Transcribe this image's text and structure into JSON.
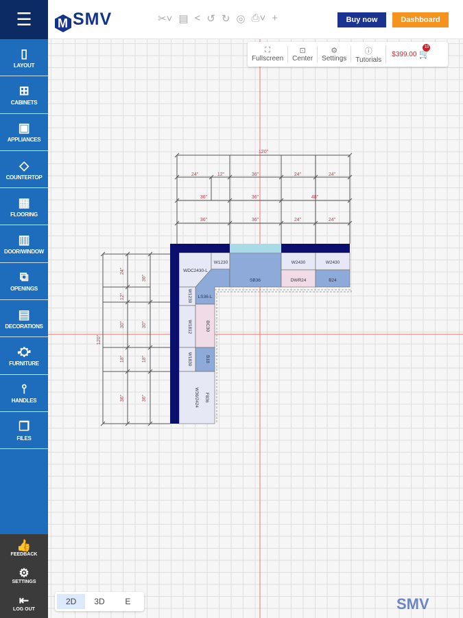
{
  "header": {
    "logo": "SMV",
    "buy_now": "Buy now",
    "dashboard": "Dashboard",
    "tools": [
      "scissors-icon",
      "save-icon",
      "share-icon",
      "undo-icon",
      "redo-icon",
      "camera-icon",
      "print-icon",
      "plus-icon"
    ]
  },
  "sidebar": {
    "items": [
      {
        "label": "LAYOUT",
        "icon": "▯"
      },
      {
        "label": "CABINETS",
        "icon": "⊞"
      },
      {
        "label": "APPLIANCES",
        "icon": "▣"
      },
      {
        "label": "COUNTERTOP",
        "icon": "◇"
      },
      {
        "label": "FLOORING",
        "icon": "▦"
      },
      {
        "label": "DOOR/WINDOW",
        "icon": "▥"
      },
      {
        "label": "OPENINGS",
        "icon": "⧉"
      },
      {
        "label": "DECORATIONS",
        "icon": "▤"
      },
      {
        "label": "FURNITURE",
        "icon": "⛮"
      },
      {
        "label": "HANDLES",
        "icon": "⫯"
      },
      {
        "label": "FILES",
        "icon": "❐"
      }
    ],
    "bottom": [
      {
        "label": "FEEDBACK",
        "icon": "👍"
      },
      {
        "label": "SETTINGS",
        "icon": "⚙"
      },
      {
        "label": "LOG OUT",
        "icon": "⇤"
      }
    ]
  },
  "viewbar": {
    "fullscreen": "Fullscreen",
    "center": "Center",
    "settings": "Settings",
    "tutorials": "Tutorials",
    "price": "$399.00",
    "cart_count": "10"
  },
  "modes": {
    "items": [
      "2D",
      "3D",
      "E"
    ],
    "active": "2D"
  },
  "watermark": "SMV",
  "plan": {
    "top_dims": {
      "total": "120\"",
      "row1": [
        "24\"",
        "12\"",
        "36\"",
        "24\"",
        "24\""
      ],
      "row2": [
        "36\"",
        "36\"",
        "48\""
      ],
      "row3": [
        "36\"",
        "36\"",
        "24\"",
        "24\""
      ]
    },
    "left_dims": {
      "total": "120\"",
      "col1": [
        "24\"",
        "12\"",
        "30\"",
        "18\"",
        "36\""
      ],
      "col2": [
        "36\"",
        "30\"",
        "18\"",
        "36\""
      ]
    },
    "cabinets": {
      "wdc": "WDC2430-L",
      "w1230a": "W1230",
      "sink": "SB36",
      "w2430a": "W2430",
      "w2430b": "W2430",
      "dwr": "DWR24",
      "b24": "B24",
      "w1230b": "W1230",
      "ls": "LS36-L",
      "w1812": "W1812",
      "bc": "BC30",
      "w1830": "W1830",
      "b18": "B18",
      "w36": "W36/2424",
      "f836": "F836"
    },
    "colors": {
      "wall": "#0a0f6e",
      "window": "#a9dbe6",
      "base": "#8eaad8",
      "wall_cab": "#e6e9f5",
      "drawer": "#f0dbe6",
      "axis": "#f07070",
      "dim_text": "#c04050"
    }
  }
}
